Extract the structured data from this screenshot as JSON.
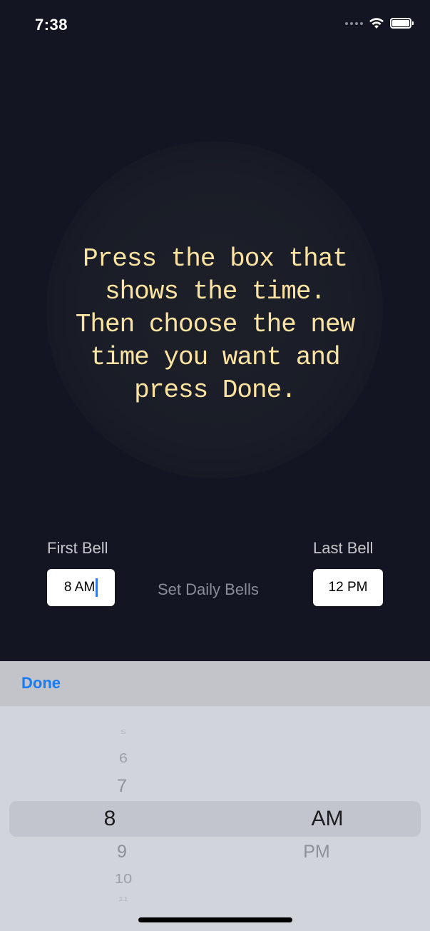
{
  "status_bar": {
    "time": "7:38",
    "icons": [
      "signal-dots-icon",
      "wifi-icon",
      "battery-icon"
    ]
  },
  "instructions": {
    "lines": [
      "Press the box that",
      "shows the time.",
      "Then choose the new",
      "time you want and",
      "press Done."
    ],
    "color": "#fbe3a2"
  },
  "bells": {
    "first_label": "First Bell",
    "first_value": "8 AM",
    "center_label": "Set Daily Bells",
    "last_label": "Last Bell",
    "last_value": "12 PM"
  },
  "toolbar": {
    "done_label": "Done",
    "accent": "#1a7cf5"
  },
  "picker": {
    "hours": [
      "5",
      "6",
      "7",
      "8",
      "9",
      "10",
      "11"
    ],
    "selected_hour": "8",
    "periods": [
      "AM",
      "PM"
    ],
    "selected_period": "AM"
  }
}
